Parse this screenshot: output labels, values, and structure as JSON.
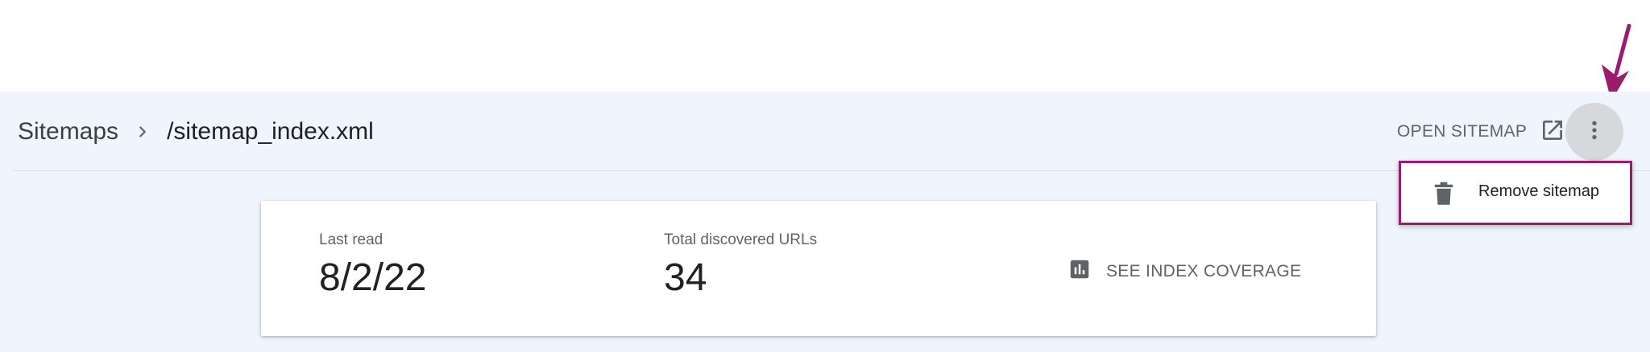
{
  "breadcrumb": {
    "root": "Sitemaps",
    "separator_icon": "chevron-right-icon",
    "current": "/sitemap_index.xml"
  },
  "toolbar": {
    "open_sitemap_label": "OPEN SITEMAP",
    "open_sitemap_icon": "open-in-new-icon",
    "more_icon": "more-vert-icon"
  },
  "menu": {
    "items": [
      {
        "label": "Remove sitemap",
        "icon": "trash-icon"
      }
    ]
  },
  "card": {
    "last_read_label": "Last read",
    "last_read_value": "8/2/22",
    "total_urls_label": "Total discovered URLs",
    "total_urls_value": "34",
    "coverage_label": "SEE INDEX COVERAGE",
    "coverage_icon": "bar-chart-icon"
  },
  "colors": {
    "background": "#f0f4fc",
    "annotation": "#9b1c6e",
    "text_primary": "#202124",
    "text_secondary": "#5f6368"
  }
}
